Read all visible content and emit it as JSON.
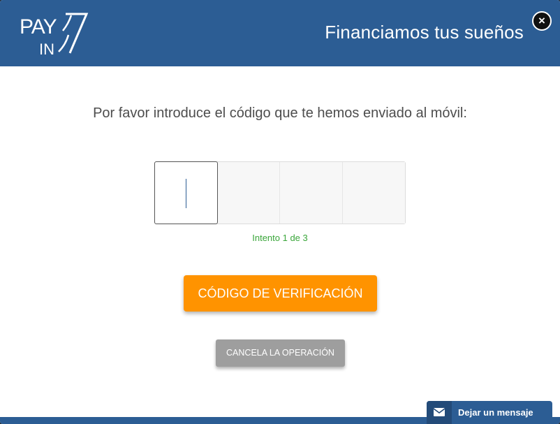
{
  "header": {
    "logo": {
      "text_top": "PAY",
      "text_bottom": "IN",
      "numeral": "7"
    },
    "title": "Financiamos tus sueños",
    "close_glyph": "×"
  },
  "main": {
    "prompt": "Por favor introduce el código que te hemos enviado al móvil:",
    "code_inputs": [
      {
        "value": "",
        "active": true
      },
      {
        "value": "",
        "active": false
      },
      {
        "value": "",
        "active": false
      },
      {
        "value": "",
        "active": false
      }
    ],
    "attempt_text": "Intento 1 de 3",
    "verify_label": "CÓDIGO DE VERIFICACIÓN",
    "cancel_label": "CANCELA LA OPERACIÓN"
  },
  "chat_widget": {
    "label": "Dejar un mensaje",
    "icon": "envelope-icon"
  },
  "colors": {
    "header": "#2c5d94",
    "verify_button": "#ff9300",
    "cancel_button": "#9e9e9e",
    "attempt_text": "#3aa63a"
  }
}
